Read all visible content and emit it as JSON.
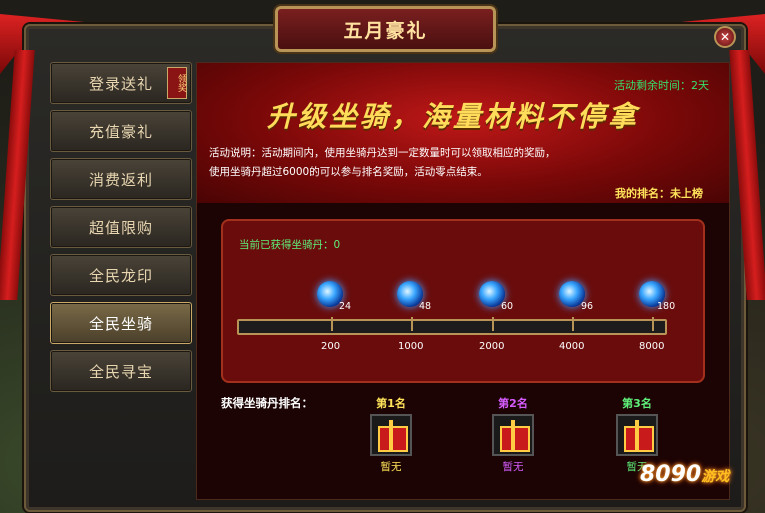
{
  "window": {
    "title": "五月豪礼",
    "close_icon": "close-icon"
  },
  "sidebar": {
    "items": [
      {
        "label": "登录送礼",
        "badge": "领奖",
        "active": false
      },
      {
        "label": "充值豪礼",
        "active": false
      },
      {
        "label": "消费返利",
        "active": false
      },
      {
        "label": "超值限购",
        "active": false
      },
      {
        "label": "全民龙印",
        "active": false
      },
      {
        "label": "全民坐骑",
        "active": true
      },
      {
        "label": "全民寻宝",
        "active": false
      }
    ]
  },
  "banner": {
    "remaining": "活动剩余时间：2天",
    "slogan": "升级坐骑，海量材料不停拿",
    "desc_line1": "活动说明：活动期间内，使用坐骑丹达到一定数量时可以领取相应的奖励，",
    "desc_line2": "使用坐骑丹超过6000的可以参与排名奖励，活动零点结束。",
    "my_rank": "我的排名：未上榜"
  },
  "progress": {
    "current": "当前已获得坐骑丹：0",
    "current_value": 0,
    "rewards": [
      {
        "threshold": "200",
        "count": "24"
      },
      {
        "threshold": "1000",
        "count": "48"
      },
      {
        "threshold": "2000",
        "count": "60"
      },
      {
        "threshold": "4000",
        "count": "96"
      },
      {
        "threshold": "8000",
        "count": "180"
      }
    ]
  },
  "ranking": {
    "title": "获得坐骑丹排名：",
    "places": [
      {
        "label": "第1名",
        "status": "暂无",
        "color": "#ffe35a"
      },
      {
        "label": "第2名",
        "status": "暂无",
        "color": "#d65cff"
      },
      {
        "label": "第3名",
        "status": "暂无",
        "color": "#5ef07a"
      }
    ]
  },
  "watermark": {
    "text": "8090",
    "sub": "游戏"
  }
}
